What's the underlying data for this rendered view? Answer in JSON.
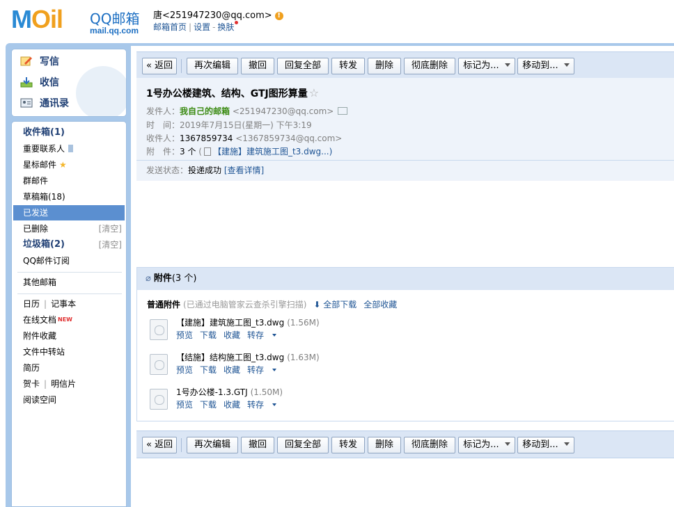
{
  "header": {
    "logo_text": "MOil",
    "brand": "QQ邮箱",
    "domain": "mail.qq.com",
    "user": "唐<251947230@qq.com>",
    "links": [
      "邮箱首页",
      "设置",
      "换肤"
    ]
  },
  "compose": {
    "write": "写信",
    "receive": "收信",
    "contacts": "通讯录"
  },
  "nav": {
    "inbox": "收件箱(1)",
    "important": "重要联系人",
    "starred": "星标邮件",
    "group": "群邮件",
    "drafts": "草稿箱(18)",
    "sent": "已发送",
    "deleted": "已删除",
    "deleted_clear": "[清空]",
    "spam": "垃圾箱(2)",
    "spam_clear": "[清空]",
    "subscribe": "QQ邮件订阅",
    "other": "其他邮箱",
    "calendar": "日历",
    "notes": "记事本",
    "docs": "在线文档",
    "docs_badge": "NEW",
    "att_collect": "附件收藏",
    "transfer": "文件中转站",
    "resume": "简历",
    "card": "贺卡",
    "postcard": "明信片",
    "reading": "阅读空间"
  },
  "toolbar": {
    "back": "« 返回",
    "reedit": "再次编辑",
    "recall": "撤回",
    "reply_all": "回复全部",
    "forward": "转发",
    "delete": "删除",
    "delete_perm": "彻底删除",
    "mark_as": "标记为...",
    "move_to": "移动到..."
  },
  "mail": {
    "subject": "1号办公楼建筑、结构、GTJ图形算量",
    "from_label": "发件人：",
    "from_name": "我自己的邮箱",
    "from_addr": "<251947230@qq.com>",
    "time_label": "时　间：",
    "time": "2019年7月15日(星期一) 下午3:19",
    "to_label": "收件人：",
    "to_name": "1367859734",
    "to_addr": "<1367859734@qq.com>",
    "att_label": "附　件：",
    "att_count": "3 个",
    "att_preview": "【建施】建筑施工图_t3.dwg...)",
    "status_label": "发送状态：",
    "status": "投递成功",
    "status_link": "[查看详情]"
  },
  "attachments": {
    "title": "附件",
    "count": "(3 个)",
    "normal": "普通附件",
    "scan": "(已通过电脑管家云查杀引擎扫描)",
    "download_all": "全部下载",
    "save_all": "全部收藏",
    "preview": "预览",
    "download": "下载",
    "collect": "收藏",
    "save_to": "转存",
    "files": [
      {
        "name": "【建施】建筑施工图_t3.dwg",
        "size": "(1.56M)"
      },
      {
        "name": "【结施】结构施工图_t3.dwg",
        "size": "(1.63M)"
      },
      {
        "name": "1号办公楼-1.3.GTJ",
        "size": "(1.50M)"
      }
    ]
  }
}
